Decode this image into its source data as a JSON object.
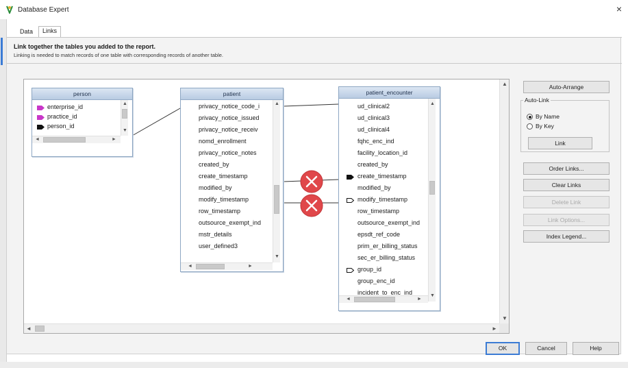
{
  "window": {
    "title": "Database Expert",
    "close_glyph": "×"
  },
  "tabs": [
    {
      "label": "Data"
    },
    {
      "label": "Links"
    }
  ],
  "page": {
    "heading": "Link together the tables you added to the report.",
    "subheading": "Linking is needed to match records of one table with corresponding records of another table."
  },
  "tables": {
    "person": {
      "title": "person",
      "fields": [
        "enterprise_id",
        "practice_id",
        "person_id"
      ]
    },
    "patient": {
      "title": "patient",
      "fields": [
        "privacy_notice_code_i",
        "privacy_notice_issued",
        "privacy_notice_receiv",
        "nomd_enrollment",
        "privacy_notice_notes",
        "created_by",
        "create_timestamp",
        "modified_by",
        "modify_timestamp",
        "row_timestamp",
        "outsource_exempt_ind",
        "mstr_details",
        "user_defined3"
      ]
    },
    "patient_encounter": {
      "title": "patient_encounter",
      "fields": [
        "ud_clinical2",
        "ud_clinical3",
        "ud_clinical4",
        "fqhc_enc_ind",
        "facility_location_id",
        "created_by",
        "create_timestamp",
        "modified_by",
        "modify_timestamp",
        "row_timestamp",
        "outsource_exempt_ind",
        "epsdt_ref_code",
        "prim_er_billing_status",
        "sec_er_billing_status",
        "group_id",
        "group_enc_id",
        "incident_to_enc_ind"
      ]
    }
  },
  "icons": {
    "magenta_key": "#c837c8",
    "black_key": "#111111",
    "error_red": "#e0474a"
  },
  "right_panel": {
    "auto_arrange": "Auto-Arrange",
    "auto_link_group": "Auto-Link",
    "by_name": "By Name",
    "by_key": "By Key",
    "link": "Link",
    "order_links": "Order Links...",
    "clear_links": "Clear Links",
    "delete_link": "Delete Link",
    "link_options": "Link Options...",
    "index_legend": "Index Legend..."
  },
  "scroll_glyphs": {
    "up": "▲",
    "down": "▼",
    "left": "◄",
    "right": "►"
  },
  "footer": {
    "ok": "OK",
    "cancel": "Cancel",
    "help": "Help"
  }
}
